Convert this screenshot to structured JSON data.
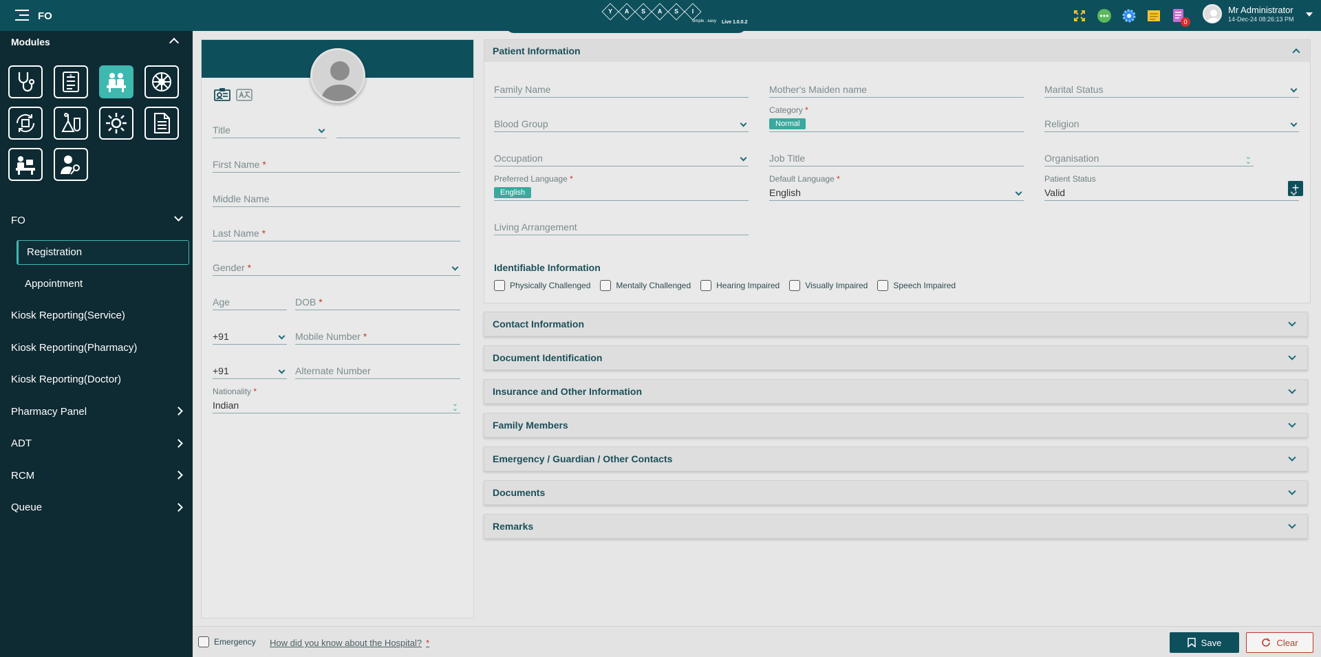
{
  "topbar": {
    "module_label": "FO",
    "logo_letters": [
      "Y",
      "A",
      "S",
      "A",
      "S",
      "I"
    ],
    "logo_tagline": "simple . easy",
    "version": "Live 1.0.0.2",
    "notification_count": "0",
    "user_name": "Mr Administrator",
    "datetime": "14-Dec-24 08:26:13 PM",
    "icons": [
      "expand-icon",
      "chat-icon",
      "settings-gear-icon",
      "sticky-note-icon",
      "notification-doc-icon"
    ]
  },
  "sidebar": {
    "modules_title": "Modules",
    "module_tiles": [
      "stethoscope-icon",
      "billing-receipt-icon",
      "front-office-icon",
      "wheel-icon",
      "refresh-box-icon",
      "lab-flask-icon",
      "settings-icon",
      "document-icon",
      "nurse-desk-icon",
      "user-key-icon"
    ],
    "active_tile_index": 2,
    "group_fo": "FO",
    "fo_items": [
      "Registration",
      "Appointment"
    ],
    "items": [
      "Kiosk Reporting(Service)",
      "Kiosk Reporting(Pharmacy)",
      "Kiosk Reporting(Doctor)",
      "Pharmacy Panel",
      "ADT",
      "RCM",
      "Queue"
    ]
  },
  "left_form": {
    "title_label": "Title",
    "first_name_label": "First Name",
    "middle_name_label": "Middle Name",
    "last_name_label": "Last Name",
    "gender_label": "Gender",
    "age_label": "Age",
    "dob_label": "DOB",
    "mobile_code": "+91",
    "mobile_label": "Mobile Number",
    "alt_code": "+91",
    "alt_label": "Alternate Number",
    "nationality_label": "Nationality",
    "nationality_value": "Indian",
    "req_mark": "*"
  },
  "patient_info": {
    "header": "Patient Information",
    "family_name": "Family Name",
    "mothers_maiden": "Mother's Maiden name",
    "marital_status": "Marital Status",
    "blood_group": "Blood Group",
    "category_label": "Category",
    "category_value": "Normal",
    "religion": "Religion",
    "occupation": "Occupation",
    "job_title": "Job Title",
    "organisation": "Organisation",
    "preferred_language_label": "Preferred Language",
    "preferred_language_value": "English",
    "default_language_label": "Default Language",
    "default_language_value": "English",
    "patient_status_label": "Patient Status",
    "patient_status_value": "Valid",
    "living_arrangement": "Living Arrangement",
    "identifiable_title": "Identifiable Information",
    "identifiable": [
      "Physically Challenged",
      "Mentally Challenged",
      "Hearing Impaired",
      "Visually Impaired",
      "Speech Impaired"
    ]
  },
  "sections": [
    "Contact Information",
    "Document Identification",
    "Insurance and Other Information",
    "Family Members",
    "Emergency / Guardian / Other Contacts",
    "Documents",
    "Remarks"
  ],
  "footer": {
    "emergency_label": "Emergency",
    "how_label": "How did you know about the Hospital?",
    "req_mark": "*",
    "save_label": "Save",
    "clear_label": "Clear"
  }
}
